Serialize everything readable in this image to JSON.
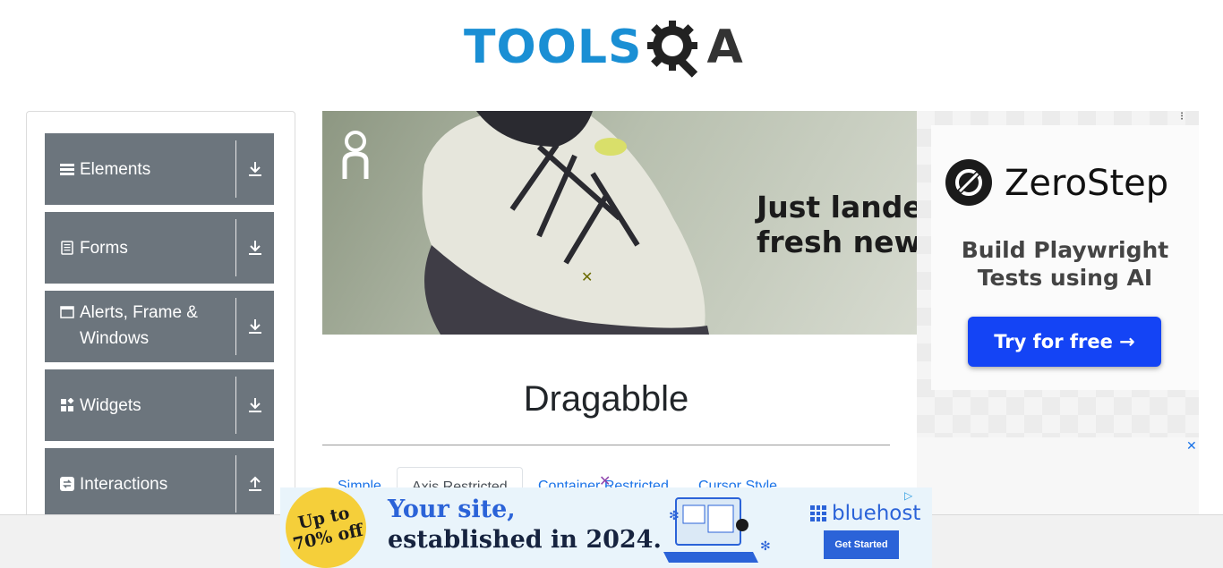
{
  "header": {
    "logo_tools": "TOOLS",
    "logo_a": "A",
    "logo_alt": "TOOLSQA"
  },
  "sidebar": {
    "groups": [
      {
        "label": "Elements",
        "icon": "list-icon",
        "arrow": "download-icon"
      },
      {
        "label": "Forms",
        "icon": "document-icon",
        "arrow": "download-icon"
      },
      {
        "label": "Alerts, Frame & Windows",
        "icon": "window-icon",
        "arrow": "download-icon"
      },
      {
        "label": "Widgets",
        "icon": "widgets-icon",
        "arrow": "download-icon"
      },
      {
        "label": "Interactions",
        "icon": "swap-icon",
        "arrow": "upload-icon"
      }
    ]
  },
  "ad_banner": {
    "brand": "On",
    "headline_line1": "Just landed",
    "headline_line2": "fresh new c"
  },
  "ad_right": {
    "brand": "ZeroStep",
    "tagline_line1": "Build Playwright",
    "tagline_line2": "Tests using AI",
    "cta": "Try for free →"
  },
  "main": {
    "title": "Dragabble",
    "tabs": [
      {
        "label": "Simple",
        "active": false
      },
      {
        "label": "Axis Restricted",
        "active": true
      },
      {
        "label": "Container Restricted",
        "active": false
      },
      {
        "label": "Cursor Style",
        "active": false
      }
    ]
  },
  "bottom_ad": {
    "badge_line1": "Up to",
    "badge_line2": "70% off",
    "headline_line1": "Your site,",
    "headline_line2": "established in 2024.",
    "brand": "bluehost",
    "cta": "Get Started"
  },
  "colors": {
    "sidebar_group_bg": "#6c757d",
    "link_blue": "#1a73e8",
    "logo_blue": "#1a8fd4",
    "zerostep_button": "#1444f5",
    "bluehost_blue": "#2b63d8"
  }
}
